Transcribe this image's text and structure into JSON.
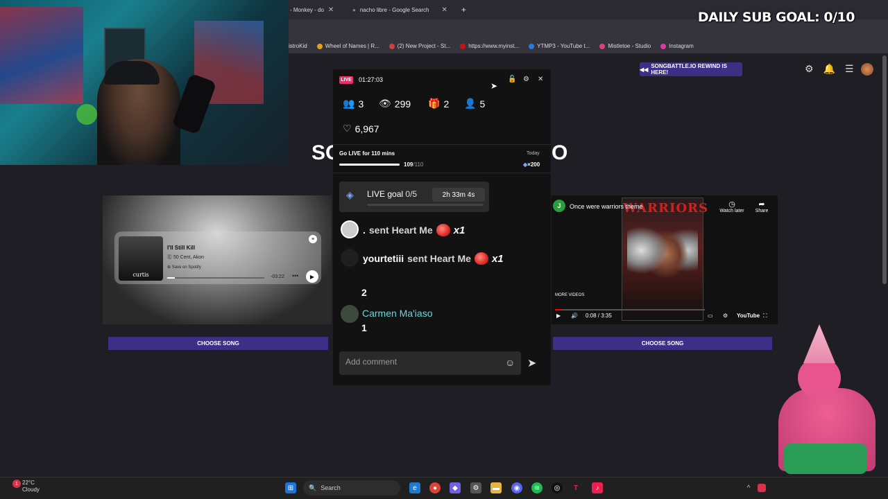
{
  "overlay": {
    "daily_goal": "DAILY SUB GOAL: 0/10"
  },
  "tabs": [
    {
      "label": "- Monkey - do"
    },
    {
      "label": "nacho libre - Google Search"
    }
  ],
  "bookmarks": [
    {
      "label": "istroKid",
      "color": "#cc4444"
    },
    {
      "label": "Wheel of Names | R...",
      "color": "#e0a020"
    },
    {
      "label": "(2) New Project - St...",
      "color": "#d04040"
    },
    {
      "label": "https://www.myinst...",
      "color": "#cc1111"
    },
    {
      "label": "YTMP3 - YouTube t...",
      "color": "#2a7ae2"
    },
    {
      "label": "Mistletoe - Studio",
      "color": "#e0407a"
    },
    {
      "label": "Instagram",
      "color": "#d83aa0"
    }
  ],
  "page": {
    "rewind_label": "SONGBATTLE.IO REWIND IS HERE!",
    "title_left": "SO",
    "title_right": "O",
    "choose_left": "CHOOSE SONG",
    "choose_right": "CHOOSE SONG"
  },
  "spotify": {
    "title": "I'll Still Kill",
    "artist": "50 Cent, Akon",
    "save": "Save on Spotify",
    "time": "-03:22",
    "album_text": "curtis",
    "progress": 0.08
  },
  "youtube": {
    "avatar": "J",
    "title": "Once were warriors theme",
    "poster_title": "WARRIORS",
    "watch_later": "Watch later",
    "share": "Share",
    "more_videos": "MORE VIDEOS",
    "time": "0:08 / 3:35",
    "brand": "YouTube",
    "progress": 0.04
  },
  "live": {
    "badge": "LIVE",
    "timer": "01:27:03",
    "stats": {
      "users": "3",
      "views": "299",
      "gifts": "2",
      "followers": "5",
      "likes": "6,967"
    },
    "go_live": "Go LIVE for 110 mins",
    "today": "Today",
    "go_live_progress": "109",
    "go_live_total": "/110",
    "go_live_ratio": 0.99,
    "reward": "×200",
    "live_goal_label": "LIVE goal",
    "live_goal_value": "0/5",
    "live_goal_time": "2h 33m 4s",
    "messages": [
      {
        "user": ".",
        "text": "sent Heart Me",
        "mult": "x1"
      },
      {
        "user": "yourtetiii",
        "text": "sent Heart Me",
        "mult": "x1"
      }
    ],
    "count_a": "2",
    "commenter": "Carmen Ma'iaso",
    "count_b": "1",
    "comment_placeholder": "Add comment"
  },
  "taskbar": {
    "temp": "22°C",
    "weather": "Cloudy",
    "badge": "1",
    "search": "Search"
  }
}
